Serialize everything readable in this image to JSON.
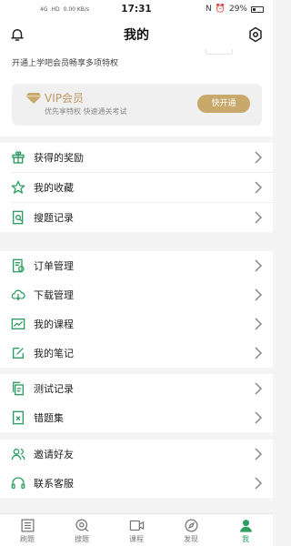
{
  "status_bar": {
    "time": "17:31",
    "left_indicators": [
      "4G",
      "HD",
      "0.00 KB/s"
    ],
    "battery": "29%"
  },
  "header": {
    "title": "我的"
  },
  "promo": {
    "text": "开通上学吧会员畅享多项特权"
  },
  "vip": {
    "title": "VIP会员",
    "subtitle": "优先享特权 快速通关考试",
    "button_label": "快开通"
  },
  "menu_groups": [
    [
      {
        "label": "获得的奖励",
        "icon": "gift-icon"
      },
      {
        "label": "我的收藏",
        "icon": "star-icon"
      },
      {
        "label": "搜题记录",
        "icon": "search-doc-icon"
      }
    ],
    [
      {
        "label": "订单管理",
        "icon": "order-icon"
      },
      {
        "label": "下载管理",
        "icon": "cloud-download-icon"
      },
      {
        "label": "我的课程",
        "icon": "chart-icon"
      },
      {
        "label": "我的笔记",
        "icon": "edit-icon"
      }
    ],
    [
      {
        "label": "测试记录",
        "icon": "copy-doc-icon"
      },
      {
        "label": "错题集",
        "icon": "wrong-doc-icon"
      }
    ],
    [
      {
        "label": "邀请好友",
        "icon": "users-icon"
      },
      {
        "label": "联系客服",
        "icon": "headset-icon"
      }
    ]
  ],
  "tabs": [
    {
      "label": "刷题",
      "icon": "list-icon"
    },
    {
      "label": "搜题",
      "icon": "search-icon"
    },
    {
      "label": "课程",
      "icon": "video-icon"
    },
    {
      "label": "发现",
      "icon": "compass-icon"
    },
    {
      "label": "我",
      "icon": "user-icon"
    }
  ],
  "colors": {
    "accent_green": "#2e9e62",
    "vip_gold": "#c9a86c"
  }
}
